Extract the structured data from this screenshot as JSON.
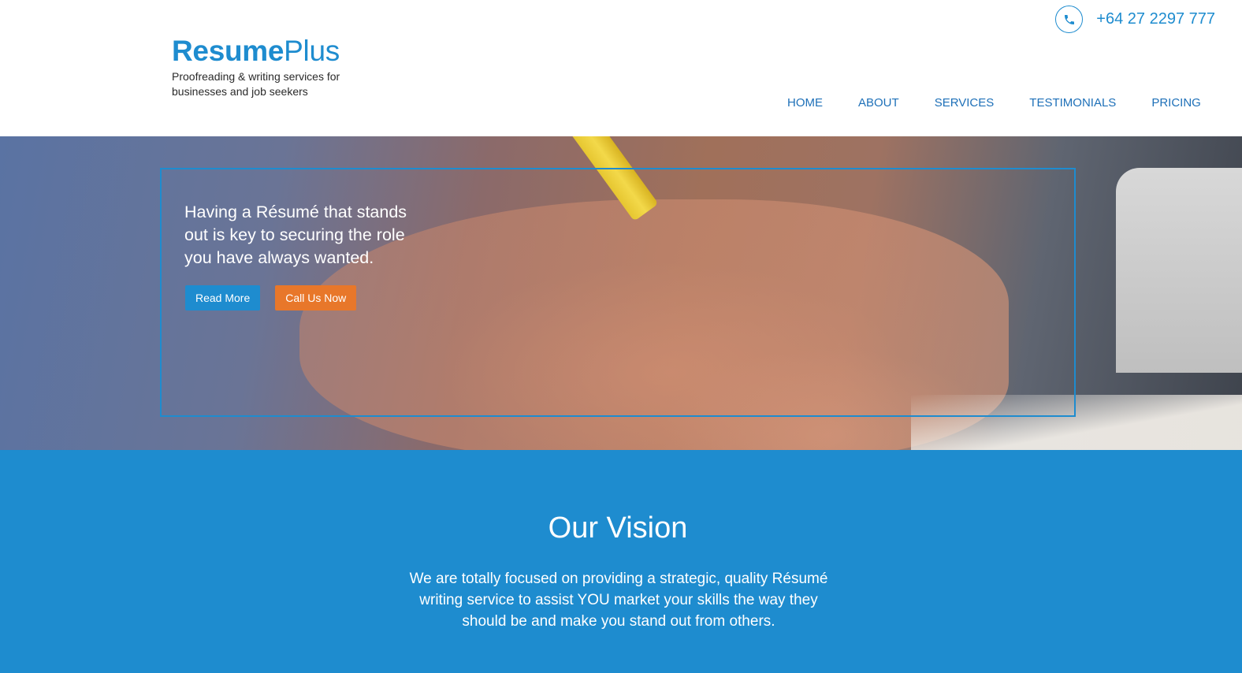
{
  "brand": {
    "name_bold": "Resume",
    "name_light": "Plus",
    "tagline": "Proofreading & writing services for businesses and job seekers"
  },
  "contact": {
    "phone": "+64 27 2297 777",
    "icon": "phone-icon"
  },
  "nav": {
    "items": [
      {
        "label": "HOME"
      },
      {
        "label": "ABOUT"
      },
      {
        "label": "SERVICES"
      },
      {
        "label": "TESTIMONIALS"
      },
      {
        "label": "PRICING"
      }
    ]
  },
  "hero": {
    "headline": "Having a Résumé that stands out is key to securing the role you have always wanted.",
    "read_more_label": "Read More",
    "call_label": "Call Us Now"
  },
  "vision": {
    "title": "Our Vision",
    "text": "We are totally focused on providing a strategic, quality Résumé writing service to assist YOU market your skills the way they should be and make you stand out from others."
  },
  "colors": {
    "brand_blue": "#1e8ccf",
    "nav_blue": "#1e70b8",
    "cta_orange": "#e8772a",
    "white": "#ffffff"
  }
}
